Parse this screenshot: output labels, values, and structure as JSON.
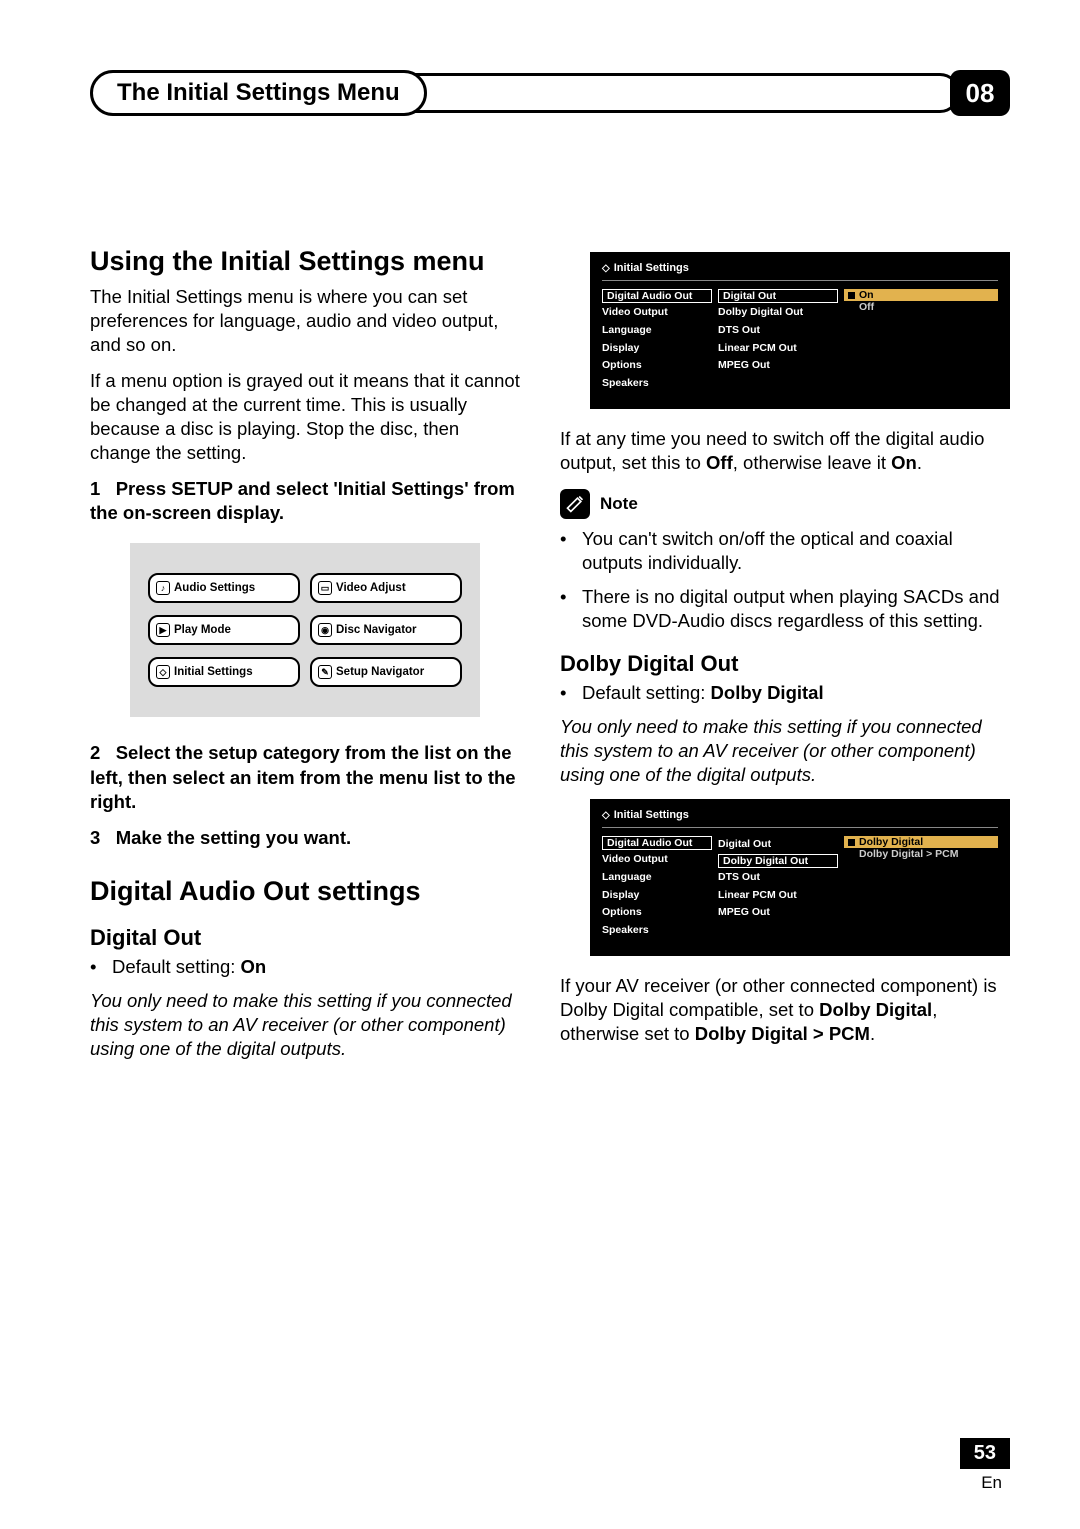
{
  "header": {
    "title": "The Initial Settings Menu",
    "chapter": "08"
  },
  "left": {
    "h1": "Using the Initial Settings menu",
    "intro1": "The Initial Settings menu is where you can set preferences for language, audio and video output, and so on.",
    "intro2": "If a menu option is grayed out it means that it cannot be changed at the current time. This is usually because a disc is playing. Stop the disc, then change the setting.",
    "step1_num": "1",
    "step1": "Press SETUP and select 'Initial Settings' from the on-screen display.",
    "menuButtons": [
      "Audio Settings",
      "Video Adjust",
      "Play Mode",
      "Disc Navigator",
      "Initial Settings",
      "Setup Navigator"
    ],
    "step2_num": "2",
    "step2": "Select the setup category from the list on the left, then select an item from the menu list to the right.",
    "step3_num": "3",
    "step3": "Make the setting you want.",
    "h1b": "Digital Audio Out settings",
    "h2_digital_out": "Digital Out",
    "digital_out_default_label": "Default setting: ",
    "digital_out_default_value": "On",
    "digital_out_note": "You only need to make this setting if you connected this system to an AV receiver (or other component) using one of the digital outputs."
  },
  "right": {
    "osd1": {
      "title": "Initial Settings",
      "col1": [
        "Digital Audio Out",
        "Video Output",
        "Language",
        "Display",
        "Options",
        "Speakers"
      ],
      "col2": [
        "Digital Out",
        "Dolby Digital Out",
        "DTS Out",
        "Linear PCM Out",
        "MPEG Out"
      ],
      "col3_selected": "On",
      "col3_other": "Off"
    },
    "p_after_osd1a": "If at any time you need to switch off the digital audio output, set this to ",
    "p_after_osd1b": "Off",
    "p_after_osd1c": ", otherwise leave it ",
    "p_after_osd1d": "On",
    "p_after_osd1e": ".",
    "note_label": "Note",
    "note_b1": "You can't switch on/off the optical and coaxial outputs individually.",
    "note_b2": "There is no digital output when playing SACDs and some DVD-Audio discs regardless of this setting.",
    "h2_dolby": "Dolby Digital Out",
    "dolby_default_label": "Default setting: ",
    "dolby_default_value": "Dolby Digital",
    "dolby_note": "You only need to make this setting if you connected this system to an AV receiver (or other component) using one of the digital outputs.",
    "osd2": {
      "title": "Initial Settings",
      "col1": [
        "Digital Audio Out",
        "Video Output",
        "Language",
        "Display",
        "Options",
        "Speakers"
      ],
      "col2": [
        "Digital Out",
        "Dolby Digital Out",
        "DTS Out",
        "Linear PCM Out",
        "MPEG Out"
      ],
      "col3_selected": "Dolby Digital",
      "col3_other": "Dolby Digital > PCM"
    },
    "p_after_osd2a": "If your AV receiver (or other connected component) is Dolby Digital compatible, set to ",
    "p_after_osd2b": "Dolby Digital",
    "p_after_osd2c": ", otherwise set to ",
    "p_after_osd2d": "Dolby Digital > PCM",
    "p_after_osd2e": "."
  },
  "footer": {
    "page": "53",
    "lang": "En"
  }
}
